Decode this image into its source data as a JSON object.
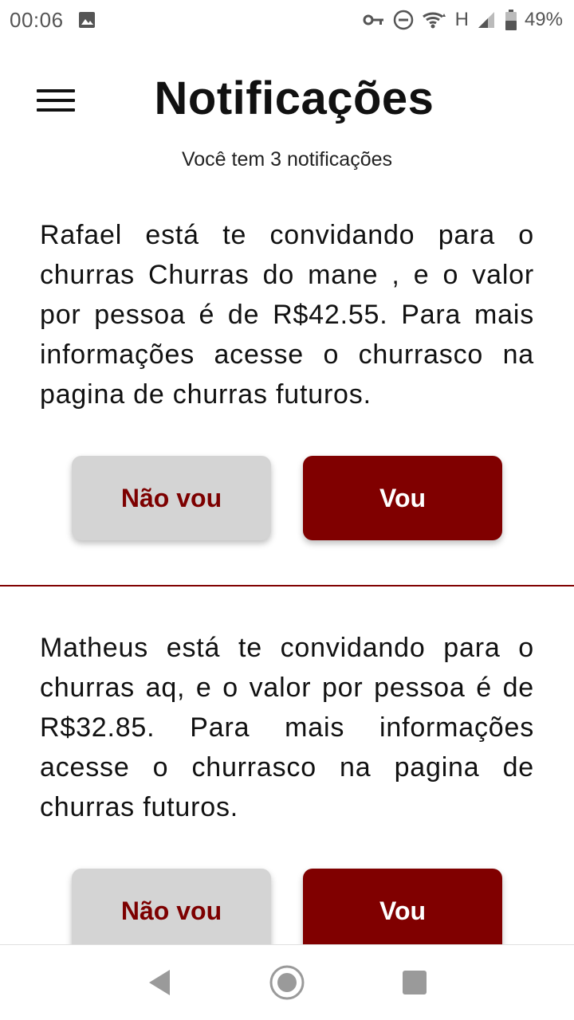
{
  "status_bar": {
    "time": "00:06",
    "network_label": "H",
    "battery": "49%",
    "icons": [
      "image-icon",
      "vpn-key-icon",
      "do-not-disturb-icon",
      "wifi-icon",
      "signal-icon",
      "battery-icon"
    ]
  },
  "header": {
    "title": "Notificações",
    "subtitle": "Você tem 3 notificações"
  },
  "notifications": [
    {
      "text": "Rafael  está te convidando para o churras Churras do mane , e o valor por pessoa é de R$42.55. Para mais informações acesse o churrasco na pagina de churras futuros.",
      "decline_label": "Não vou",
      "accept_label": "Vou"
    },
    {
      "text": "Matheus está te convidando para o churras aq, e o valor por pessoa é de R$32.85. Para mais informações acesse o churrasco na pagina de churras futuros.",
      "decline_label": "Não vou",
      "accept_label": "Vou"
    }
  ],
  "colors": {
    "accent": "#800000",
    "decline_bg": "#d4d4d4",
    "decline_text": "#7d0000"
  },
  "nav": {
    "icons": [
      "back-icon",
      "home-icon",
      "recents-icon"
    ]
  }
}
